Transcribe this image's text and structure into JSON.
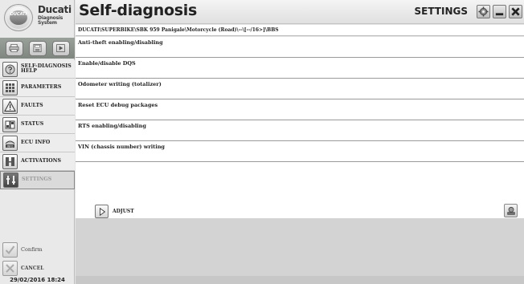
{
  "brand": {
    "logo_text": "DUCATI",
    "name": "Ducati",
    "line2": "Diagnosis",
    "line3": "System"
  },
  "header": {
    "title": "Self-diagnosis",
    "section": "SETTINGS"
  },
  "breadcrumb": "DUCATI\\SUPERBIKE\\SBK 959 Panigale\\Motorcycle (Road)\\--\\[--/16>]\\BBS",
  "toolbar": {
    "icons": [
      "print-icon",
      "save-icon",
      "play-icon"
    ]
  },
  "sidebar": {
    "items": [
      {
        "label": "SELF-DIAGNOSIS HELP",
        "icon": "help-icon",
        "active": false
      },
      {
        "label": "PARAMETERS",
        "icon": "parameters-icon",
        "active": false
      },
      {
        "label": "FAULTS",
        "icon": "warning-icon",
        "active": false
      },
      {
        "label": "STATUS",
        "icon": "status-icon",
        "active": false
      },
      {
        "label": "ECU INFO",
        "icon": "info-icon",
        "active": false
      },
      {
        "label": "ACTIVATIONS",
        "icon": "activations-icon",
        "active": false
      },
      {
        "label": "SETTINGS",
        "icon": "settings-icon",
        "active": true
      }
    ],
    "confirm_label": "Confirm",
    "cancel_label": "CANCEL",
    "datetime": "29/02/2016  18:24"
  },
  "functions": [
    "Anti-theft enabling/disabling",
    "Enable/disable DQS",
    "Odometer writing (totalizer)",
    "Reset ECU debug packages",
    "RTS enabling/disabling",
    "VIN (chassis number) writing"
  ],
  "actions": {
    "adjust_label": "ADJUST"
  }
}
